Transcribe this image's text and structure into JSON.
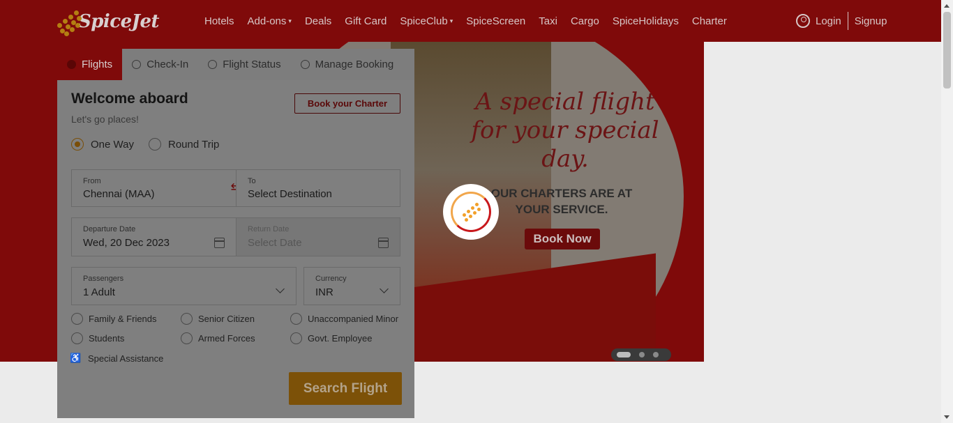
{
  "brand": {
    "logo_text": "SpiceJet"
  },
  "nav": {
    "items": [
      {
        "label": "Hotels",
        "caret": ""
      },
      {
        "label": "Add-ons",
        "caret": "▾"
      },
      {
        "label": "Deals",
        "caret": ""
      },
      {
        "label": "Gift Card",
        "caret": ""
      },
      {
        "label": "SpiceClub",
        "caret": "▾"
      },
      {
        "label": "SpiceScreen",
        "caret": ""
      },
      {
        "label": "Taxi",
        "caret": ""
      },
      {
        "label": "Cargo",
        "caret": ""
      },
      {
        "label": "SpiceHolidays",
        "caret": ""
      },
      {
        "label": "Charter",
        "caret": ""
      }
    ]
  },
  "auth": {
    "login": "Login",
    "signup": "Signup"
  },
  "tabs": [
    {
      "label": "Flights",
      "icon": "flight-icon"
    },
    {
      "label": "Check-In",
      "icon": "check-icon"
    },
    {
      "label": "Flight Status",
      "icon": "clock-icon"
    },
    {
      "label": "Manage Booking",
      "icon": "sliders-icon"
    }
  ],
  "booking": {
    "welcome": "Welcome aboard",
    "tagline": "Let's go places!",
    "charter_button": "Book your Charter",
    "trip_types": [
      {
        "label": "One Way",
        "selected": true
      },
      {
        "label": "Round Trip",
        "selected": false
      }
    ],
    "from": {
      "label": "From",
      "value": "Chennai (MAA)"
    },
    "to": {
      "label": "To",
      "value": "Select Destination"
    },
    "departure": {
      "label": "Departure Date",
      "value": "Wed, 20 Dec 2023"
    },
    "return": {
      "label": "Return Date",
      "value": "Select Date"
    },
    "passengers": {
      "label": "Passengers",
      "value": "1 Adult"
    },
    "currency": {
      "label": "Currency",
      "value": "INR"
    },
    "options": [
      "Family & Friends",
      "Senior Citizen",
      "Unaccompanied Minor",
      "Students",
      "Armed Forces",
      "Govt. Employee"
    ],
    "special_assistance": "Special Assistance",
    "search_button": "Search Flight"
  },
  "hero": {
    "title": "A special flight for your special day.",
    "subtitle": "OUR CHARTERS ARE AT YOUR SERVICE.",
    "cta": "Book Now",
    "slides": 3,
    "active_slide": 1
  },
  "colors": {
    "brand_red": "#c8181c",
    "accent_orange": "#f2a02a",
    "overlay": "rgba(0,0,0,0.5)"
  }
}
